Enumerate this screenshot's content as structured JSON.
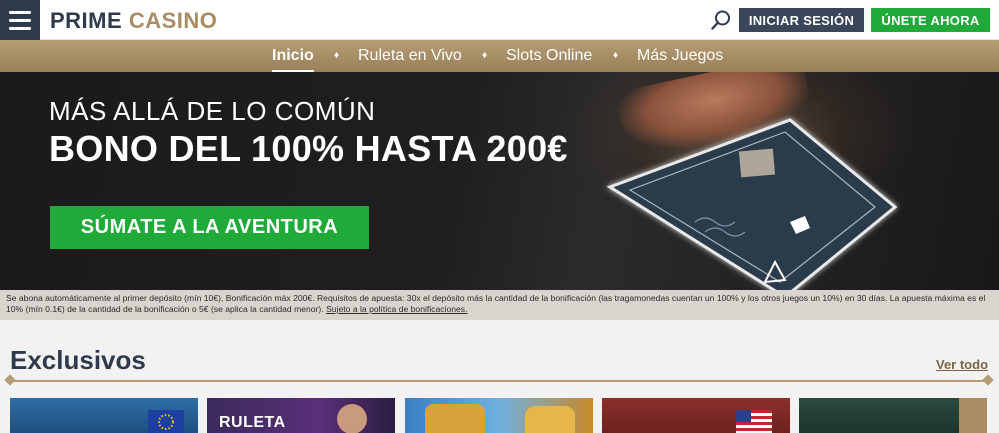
{
  "header": {
    "brand_part1": "PRIME",
    "brand_part2": "CASINO",
    "login_label": "INICIAR SESIÓN",
    "join_label": "ÚNETE AHORA",
    "icons": [
      "menu-icon",
      "search-icon"
    ]
  },
  "nav": {
    "items": [
      {
        "label": "Inicio",
        "active": true
      },
      {
        "label": "Ruleta en Vivo",
        "active": false
      },
      {
        "label": "Slots Online",
        "active": false
      },
      {
        "label": "Más Juegos",
        "active": false
      }
    ],
    "separator": "♦"
  },
  "hero": {
    "subtitle": "MÁS ALLÁ DE LO COMÚN",
    "title": "BONO DEL 100% HASTA 200€",
    "cta_label": "SÚMATE A LA AVENTURA"
  },
  "terms": {
    "text": "Se abona automáticamente al primer depósito (mín 10€), Bonificación máx 200€. Requisitos de apuesta: 30x el depósito más la cantidad de la bonificación (las tragamonedas cuentan un 100% y los otros juegos un 10%) en 30 días. La apuesta máxima es el 10% (mín 0.1€) de la cantidad de la bonificación o 5€ (se aplica la cantidad menor).",
    "link_label": "Sujeto a la política de bonificaciones."
  },
  "exclusives": {
    "title": "Exclusivos",
    "see_all_label": "Ver todo",
    "tiles": [
      {
        "label": "",
        "flag": "eu-flag-icon",
        "color": "#2d6ea8"
      },
      {
        "label": "RULETA",
        "flag": "",
        "color": "#3c2a5a"
      },
      {
        "label": "",
        "flag": "",
        "color": "#3a7fc4"
      },
      {
        "label": "",
        "flag": "us-flag-icon",
        "color": "#8c2f2b"
      },
      {
        "label": "",
        "flag": "",
        "color": "#2b4a3e"
      }
    ]
  },
  "colors": {
    "navy": "#2f3b4d",
    "gold": "#a88d63",
    "green": "#1faa3a"
  }
}
